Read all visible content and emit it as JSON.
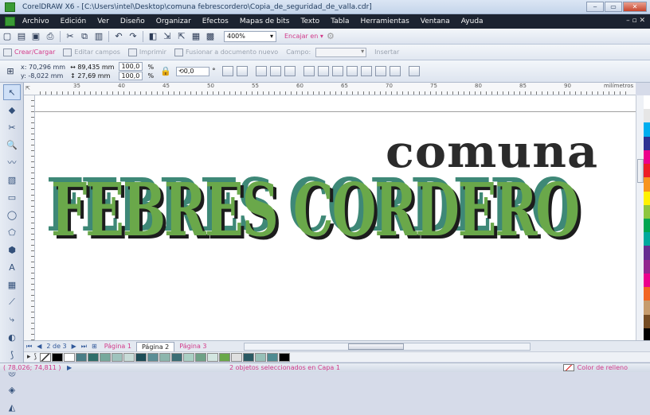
{
  "window": {
    "title": "CorelDRAW X6 - [C:\\Users\\intel\\Desktop\\comuna febrescordero\\Copia_de_seguridad_de_valla.cdr]"
  },
  "menu": [
    "Archivo",
    "Edición",
    "Ver",
    "Diseño",
    "Organizar",
    "Efectos",
    "Mapas de bits",
    "Texto",
    "Tabla",
    "Herramientas",
    "Ventana",
    "Ayuda"
  ],
  "standard": {
    "zoom": "400%",
    "snap": "Encajar en"
  },
  "merge": {
    "create": "Crear/Cargar",
    "edit": "Editar campos",
    "print": "Imprimir",
    "merge": "Fusionar a documento nuevo",
    "field": "Campo:",
    "insert": "Insertar"
  },
  "props": {
    "x": "x: 70,296 mm",
    "y": "y: -8,022 mm",
    "w": "89,435 mm",
    "h": "27,69 mm",
    "sx": "100,0",
    "sy": "100,0",
    "pct": "%",
    "rotate": "0,0",
    "deg": "°"
  },
  "ruler": {
    "unit": "milímetros",
    "labels": [
      "35",
      "40",
      "45",
      "50",
      "55",
      "60",
      "65",
      "70",
      "75",
      "80",
      "85",
      "90"
    ]
  },
  "art": {
    "top": "comuna",
    "main": "FEBRES CORDERO"
  },
  "pages": {
    "counter": "2 de 3",
    "tabs": [
      "Página 1",
      "Página 2",
      "Página 3"
    ],
    "active": 1
  },
  "status": {
    "coords": "( 78,026; 74,811 )",
    "message": "2 objetos seleccionados en Capa 1",
    "fill": "Color de relleno"
  },
  "colors": {
    "brand_green": "#6aa84a",
    "teal": "#3e8877",
    "shadow": "#1c1c1c",
    "accent_pink": "#d23a8a"
  },
  "palette_bottom": [
    "#000000",
    "#ffffff",
    "#4a7d86",
    "#2f6f6b",
    "#77a99c",
    "#9fc3bd",
    "#c8dcd8",
    "#1d4d57",
    "#5b8e96",
    "#8cb6ad",
    "#3b6e75",
    "#aad0c4",
    "#6fa186",
    "#d3e6e0",
    "#6aa84a",
    "#e0e0e0",
    "#2a5963",
    "#97c0b8",
    "#4f8b92",
    "#000000"
  ],
  "palette_side": [
    "#ffffff",
    "#e6e6e6",
    "#00aeef",
    "#2e3192",
    "#ec008c",
    "#ed1c24",
    "#f7941d",
    "#fff200",
    "#8dc63f",
    "#00a651",
    "#00a99d",
    "#662d91",
    "#92278f",
    "#ec008c",
    "#f26522",
    "#c69c6d",
    "#754c24",
    "#000000"
  ]
}
